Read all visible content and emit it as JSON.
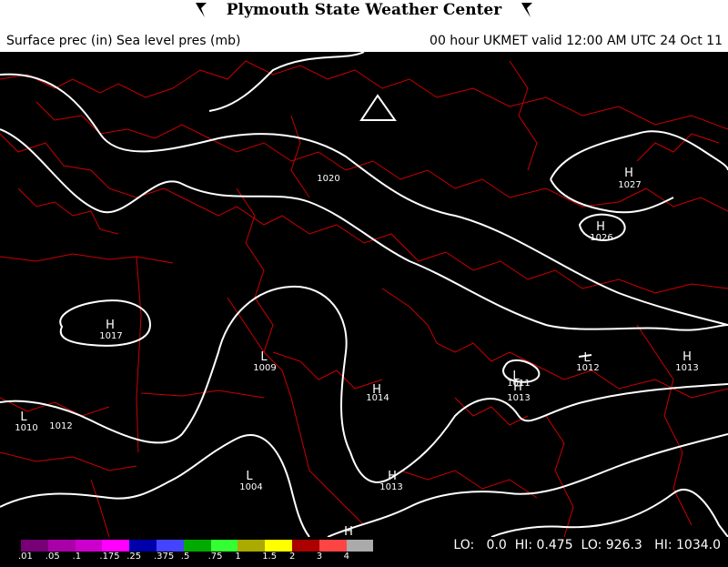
{
  "header": {
    "title": "Plymouth State Weather Center",
    "subtitle_left": "Surface prec (in) Sea level pres (mb)",
    "subtitle_right": "00 hour UKMET valid 12:00 AM UTC 24 Oct 11"
  },
  "map": {
    "isobar_labels": [
      "1020",
      "1027",
      "1026",
      "1017",
      "1009",
      "1014",
      "1011",
      "1013",
      "1012",
      "1013",
      "1010",
      "1012",
      "1004",
      "1013"
    ],
    "pressure_centers": [
      {
        "type": "H",
        "value": "1027"
      },
      {
        "type": "H",
        "value": "1026"
      },
      {
        "type": "H",
        "value": "1017"
      },
      {
        "type": "L",
        "value": "1009"
      },
      {
        "type": "H",
        "value": "1014"
      },
      {
        "type": "L",
        "value": "1011"
      },
      {
        "type": "H",
        "value": "1013"
      },
      {
        "type": "L",
        "value": "1012"
      },
      {
        "type": "H",
        "value": "1013"
      },
      {
        "type": "L",
        "value": "1010"
      },
      {
        "type": "L",
        "value": "1004"
      },
      {
        "type": "H",
        "value": "1013"
      },
      {
        "type": "H",
        "value": ""
      }
    ],
    "colors": {
      "background": "#000000",
      "isobars": "#ffffff",
      "borders": "#cc0000"
    }
  },
  "legend": {
    "labels": [
      ".01",
      ".05",
      ".1",
      ".175",
      ".25",
      ".375",
      ".5",
      ".75",
      "1",
      "1.5",
      "2",
      "3",
      "4"
    ],
    "colors": [
      "#770077",
      "#aa00aa",
      "#cc00cc",
      "#ff00ff",
      "#0000aa",
      "#4444ff",
      "#00aa00",
      "#33ff33",
      "#aaaa00",
      "#ffff00",
      "#aa0000",
      "#ff4444",
      "#aaaaaa"
    ]
  },
  "stats": {
    "text": "LO:   0.0  HI: 0.475  LO: 926.3   HI: 1034.0"
  }
}
